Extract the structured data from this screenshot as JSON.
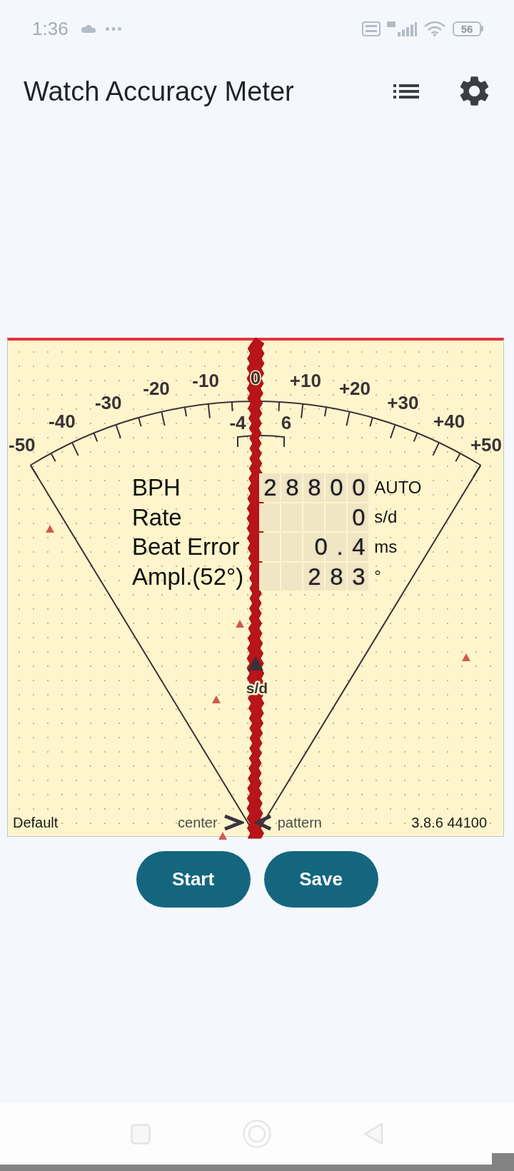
{
  "status_bar": {
    "time": "1:36",
    "battery": "56"
  },
  "app_bar": {
    "title": "Watch Accuracy Meter"
  },
  "meter": {
    "scale_labels": [
      "-50",
      "-40",
      "-30",
      "-20",
      "-10",
      "0",
      "+10",
      "+20",
      "+30",
      "+40",
      "+50"
    ],
    "tolerance_labels": [
      "-4",
      "6"
    ],
    "readings": [
      {
        "label": "BPH",
        "value": "28800",
        "unit": "AUTO"
      },
      {
        "label": "Rate",
        "value": "0",
        "unit": "s/d"
      },
      {
        "label": "Beat Error",
        "value": "0.4",
        "unit": "ms"
      },
      {
        "label": "Ampl.(52°)",
        "value": "283",
        "unit": "°"
      }
    ],
    "pointer_label": "s/d",
    "footer": {
      "profile": "Default",
      "left_label": "center",
      "right_label": "pattern",
      "version": "3.8.6 44100"
    }
  },
  "buttons": [
    {
      "label": "Start"
    },
    {
      "label": "Save"
    }
  ]
}
